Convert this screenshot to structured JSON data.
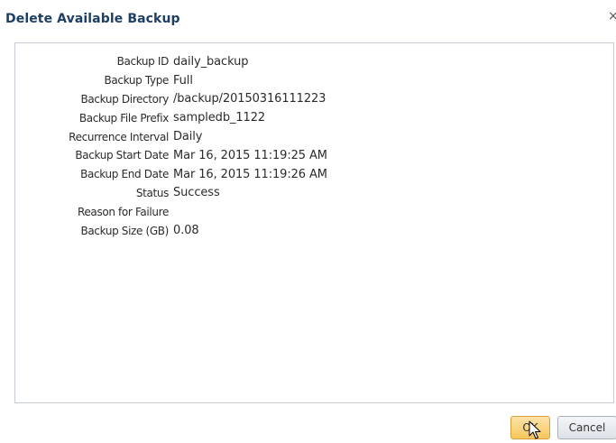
{
  "dialog": {
    "title": "Delete Available Backup",
    "close_glyph": "×"
  },
  "details": [
    {
      "label": "Backup ID",
      "value": "daily_backup"
    },
    {
      "label": "Backup Type",
      "value": "Full"
    },
    {
      "label": "Backup Directory",
      "value": "/backup/20150316111223"
    },
    {
      "label": "Backup File Prefix",
      "value": "sampledb_1122"
    },
    {
      "label": "Recurrence Interval",
      "value": "Daily"
    },
    {
      "label": "Backup Start Date",
      "value": "Mar 16, 2015 11:19:25 AM"
    },
    {
      "label": "Backup End Date",
      "value": "Mar 16, 2015 11:19:26 AM"
    },
    {
      "label": "Status",
      "value": "Success"
    },
    {
      "label": "Reason for Failure",
      "value": ""
    },
    {
      "label": "Backup Size (GB)",
      "value": "0.08"
    }
  ],
  "buttons": {
    "ok_label": "OK",
    "cancel_label": "Cancel"
  },
  "colors": {
    "title": "#1d3f66",
    "ok_button": "#f7c75c",
    "panel_border": "#c8cdd4"
  },
  "icons": {
    "close": "close-icon",
    "cursor": "mouse-pointer-icon"
  }
}
